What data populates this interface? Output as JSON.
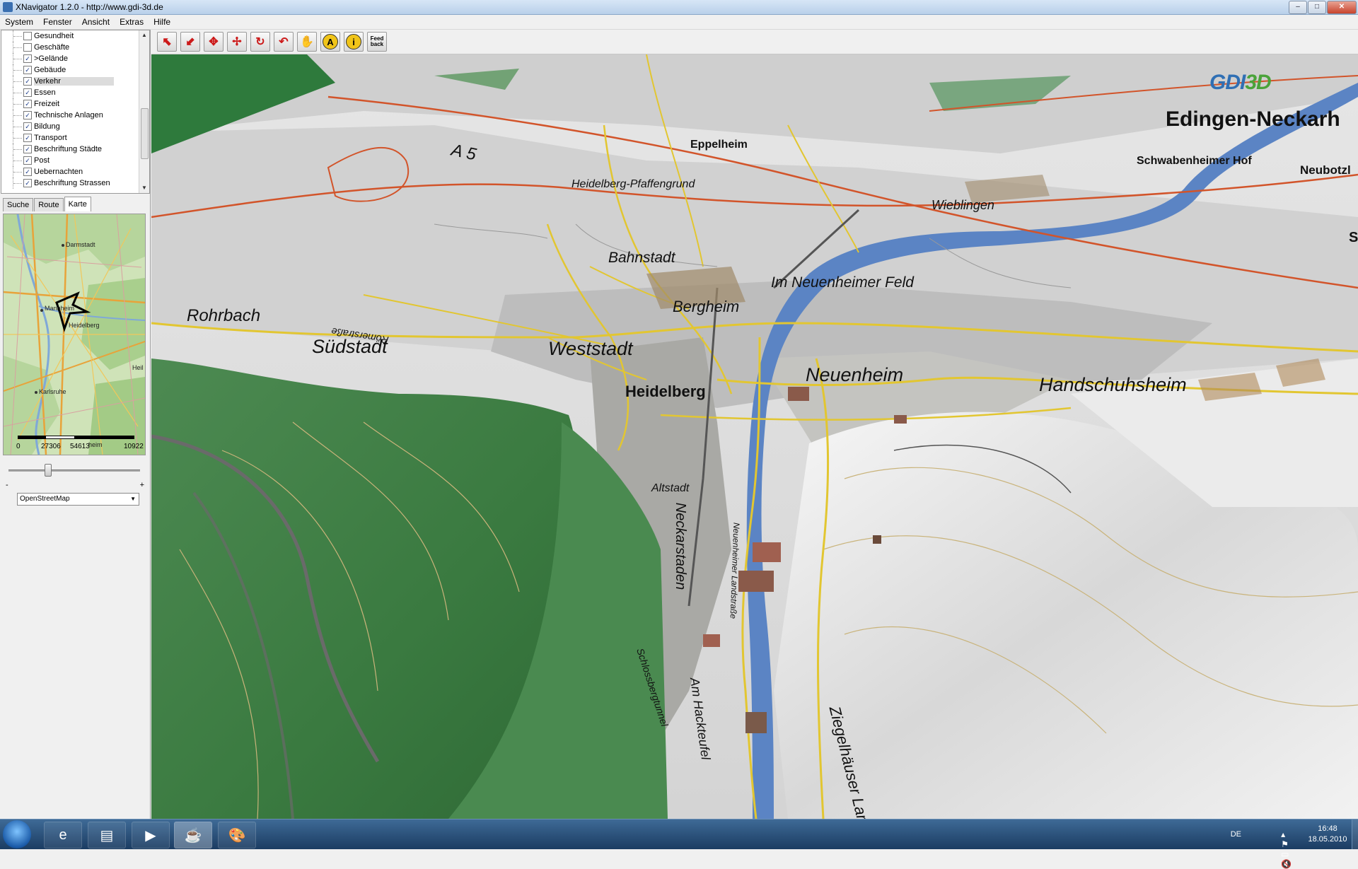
{
  "window": {
    "title": "XNavigator 1.2.0 - http://www.gdi-3d.de",
    "minimize": "–",
    "maximize": "□",
    "close": "✕"
  },
  "menu": [
    "System",
    "Fenster",
    "Ansicht",
    "Extras",
    "Hilfe"
  ],
  "layers": [
    {
      "label": "Gesundheit",
      "checked": false,
      "check": ""
    },
    {
      "label": "Geschäfte",
      "checked": false,
      "check": ""
    },
    {
      "label": ">Gelände",
      "checked": true,
      "check": "✓"
    },
    {
      "label": "Gebäude",
      "checked": true,
      "check": "✓"
    },
    {
      "label": "Verkehr",
      "checked": true,
      "check": "✓",
      "selected": true
    },
    {
      "label": "Essen",
      "checked": true,
      "check": "✓"
    },
    {
      "label": "Freizeit",
      "checked": true,
      "check": "✓"
    },
    {
      "label": "Technische Anlagen",
      "checked": true,
      "check": "✓"
    },
    {
      "label": "Bildung",
      "checked": true,
      "check": "✓"
    },
    {
      "label": "Transport",
      "checked": true,
      "check": "✓"
    },
    {
      "label": "Beschriftung Städte",
      "checked": true,
      "check": "✓"
    },
    {
      "label": "Post",
      "checked": true,
      "check": "✓"
    },
    {
      "label": "Uebernachten",
      "checked": true,
      "check": "✓"
    },
    {
      "label": "Beschriftung Strassen",
      "checked": true,
      "check": "✓"
    }
  ],
  "tabs": [
    "Suche",
    "Route",
    "Karte"
  ],
  "active_tab": "Karte",
  "overview_map": {
    "labels": [
      "Darmstadt",
      "Mannheim",
      "Heidelberg",
      "Heil",
      "Karlsruhe",
      "heim"
    ],
    "scale": [
      "0",
      "27306",
      "54613",
      "10922"
    ]
  },
  "zoom": {
    "minus": "-",
    "plus": "+",
    "level": 0.27
  },
  "basemap": {
    "selected": "OpenStreetMap",
    "arrow": "▼"
  },
  "toolbar": {
    "icons": [
      "zoom-in-icon",
      "zoom-out-icon",
      "pan-icon",
      "move-icon",
      "rotate-icon",
      "back-icon",
      "hand-icon",
      "annotation-icon",
      "info-icon",
      "feedback-icon"
    ],
    "glyphs": [
      "⬉",
      "⬋",
      "✥",
      "✢",
      "↻",
      "↶",
      "✋",
      "A",
      "i",
      "Feed back"
    ]
  },
  "map": {
    "logo_a": "GDI",
    "logo_b": "3D",
    "places": [
      {
        "text": "Edingen-Neckarh",
        "style": "bold"
      },
      {
        "text": "Schwabenheimer Hof",
        "style": "bold"
      },
      {
        "text": "Neubotzl",
        "style": "bold"
      },
      {
        "text": "Eppelheim",
        "style": "bold"
      },
      {
        "text": "A 5",
        "style": "it"
      },
      {
        "text": "Heidelberg-Pfaffengrund",
        "style": "it"
      },
      {
        "text": "Wieblingen",
        "style": "it"
      },
      {
        "text": "Bahnstadt",
        "style": "it"
      },
      {
        "text": "Im Neuenheimer Feld",
        "style": "it"
      },
      {
        "text": "Rohrbach",
        "style": "it"
      },
      {
        "text": "Bergheim",
        "style": "it"
      },
      {
        "text": "Südstadt",
        "style": "it"
      },
      {
        "text": "Römerstraße",
        "style": "it"
      },
      {
        "text": "Weststadt",
        "style": "it"
      },
      {
        "text": "Neuenheim",
        "style": "it"
      },
      {
        "text": "Handschuhsheim",
        "style": "it"
      },
      {
        "text": "Heidelberg",
        "style": "bold"
      },
      {
        "text": "Altstadt",
        "style": "it"
      },
      {
        "text": "Neckarstaden",
        "style": "it"
      },
      {
        "text": "Neuenheimer Landstraße",
        "style": "it"
      },
      {
        "text": "Schlossbergtunnel",
        "style": "it"
      },
      {
        "text": "Am Hackteufel",
        "style": "it"
      },
      {
        "text": "Ziegelhäuser Lands",
        "style": "it"
      },
      {
        "text": "S",
        "style": "bold"
      }
    ],
    "colors": {
      "forest": "#3f7d45",
      "river": "#5b84c4",
      "road": "#e2c631",
      "highway": "#d2542a"
    }
  },
  "taskbar": {
    "apps": [
      "ie-icon",
      "explorer-icon",
      "media-player-icon",
      "java-icon",
      "paint-icon"
    ],
    "glyphs": [
      "e",
      "▤",
      "▶",
      "☕",
      "🎨"
    ],
    "lang": "DE",
    "tray_icons": "▴ ⚑ ▭ 🔇",
    "time": "16:48",
    "date": "18.05.2010"
  }
}
